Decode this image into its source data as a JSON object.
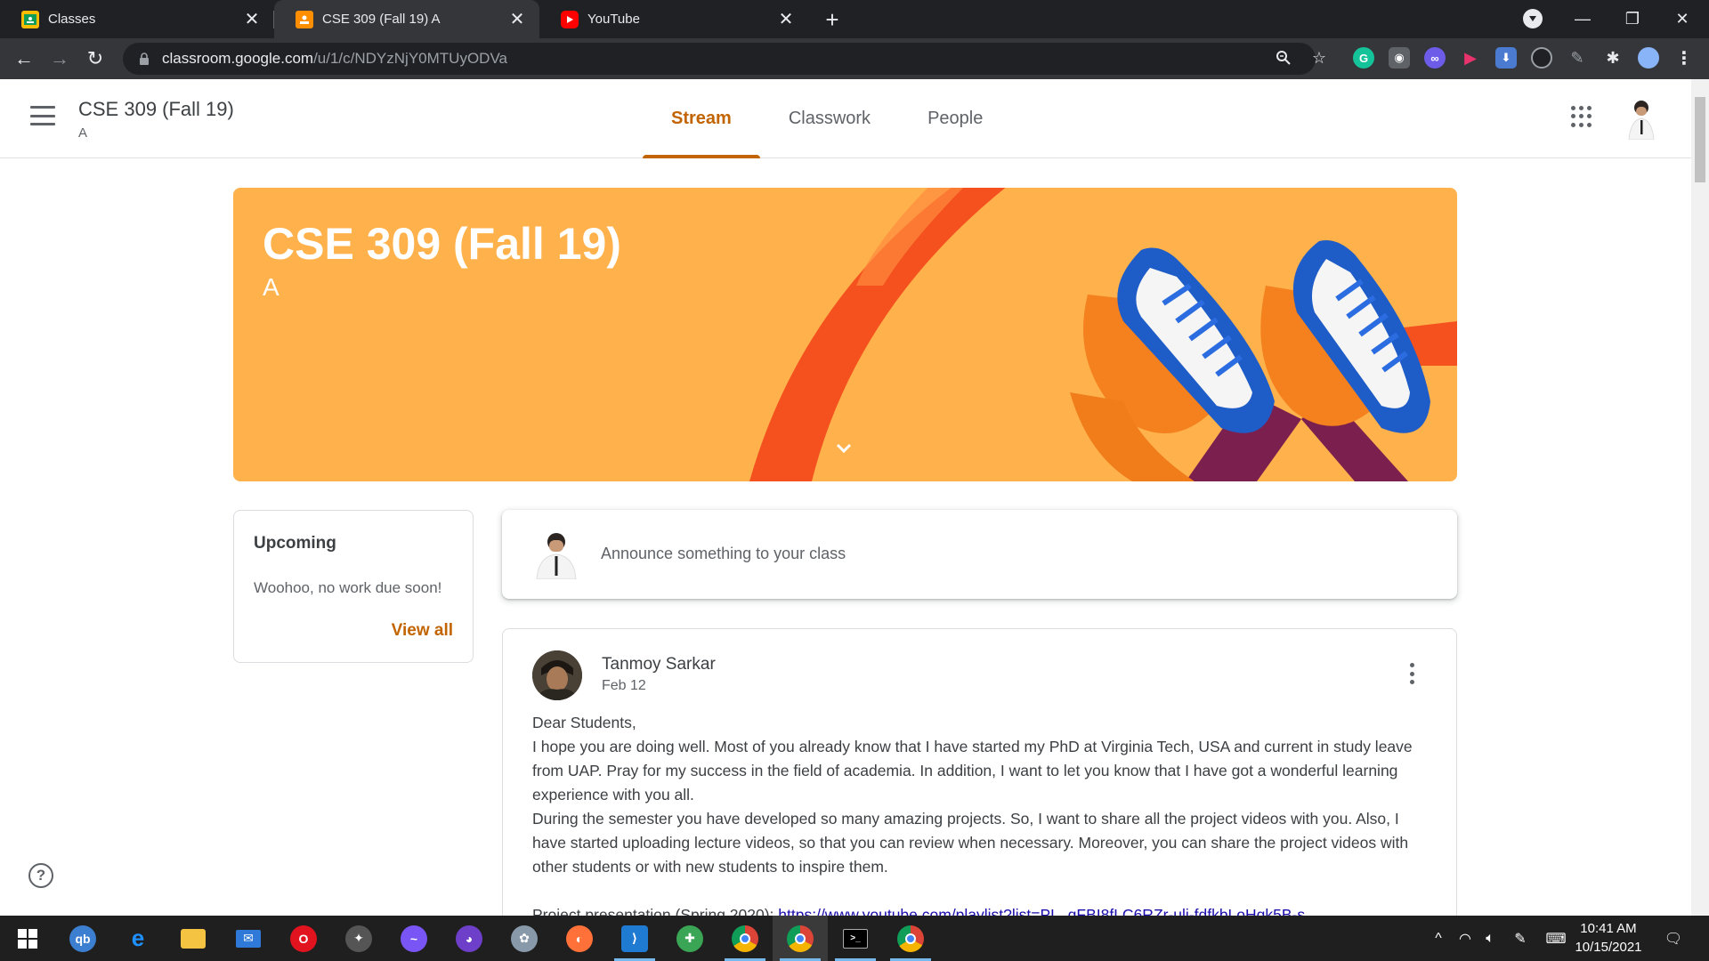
{
  "browser": {
    "tabs": [
      {
        "title": "Classes",
        "favicon": "google-classroom-icon",
        "active": false
      },
      {
        "title": "CSE 309 (Fall 19) A",
        "favicon": "google-classroom-icon",
        "active": true
      },
      {
        "title": "YouTube",
        "favicon": "youtube-icon",
        "active": false
      }
    ],
    "url_domain": "classroom.google.com",
    "url_path": "/u/1/c/NDYzNjY0MTUyODVa"
  },
  "header": {
    "class_title": "CSE 309 (Fall 19)",
    "class_section": "A",
    "tabs": [
      "Stream",
      "Classwork",
      "People"
    ],
    "active_tab": "Stream"
  },
  "banner": {
    "title": "CSE 309 (Fall 19)",
    "section": "A"
  },
  "upcoming": {
    "title": "Upcoming",
    "empty_text": "Woohoo, no work due soon!",
    "view_all": "View all"
  },
  "announce": {
    "placeholder": "Announce something to your class"
  },
  "post": {
    "author": "Tanmoy Sarkar",
    "date": "Feb 12",
    "greeting": "Dear Students,",
    "paragraph1": "I hope you are doing well. Most of you already know that I have started my PhD at Virginia Tech, USA and current in study leave from UAP. Pray for my success in the field of academia. In addition, I want to let you know that I have got a wonderful learning experience with you all.",
    "paragraph2": "During the semester you have developed so many amazing projects. So, I want to share all the project videos with you. Also, I have started uploading lecture videos, so that you can review when necessary. Moreover, you can share the project videos with other students or with new students to inspire them.",
    "link_label": "Project presentation (Spring 2020): ",
    "link_url": "https://www.youtube.com/playlist?list=PL_qFBI8fLC6RZr-uli-fdfkbLoHqk5B-s"
  },
  "taskbar": {
    "time": "10:41 AM",
    "date": "10/15/2021"
  },
  "colors": {
    "accent": "#c26401",
    "banner": "#ffb14b",
    "chrome_dark": "#202124"
  }
}
